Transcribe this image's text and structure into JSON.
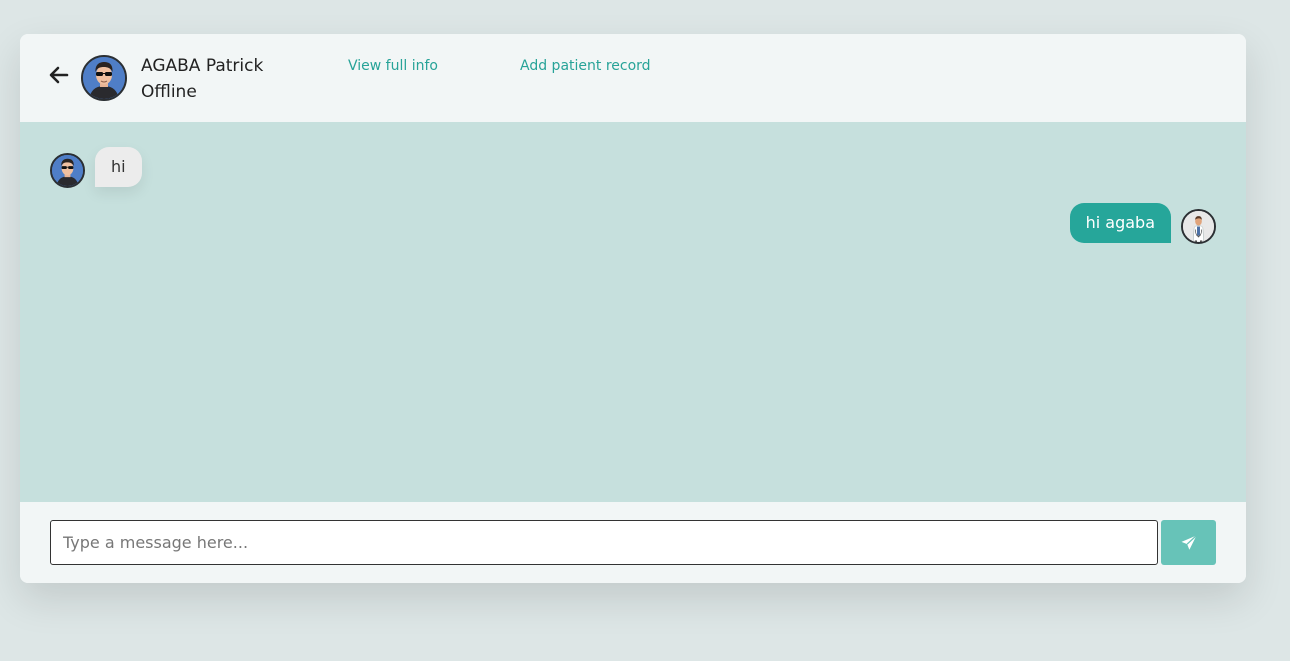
{
  "header": {
    "back_icon": "arrow-left-icon",
    "contact_name": "AGABA Patrick",
    "contact_status": "Offline",
    "view_info_label": "View full info",
    "add_record_label": "Add patient record"
  },
  "messages": [
    {
      "direction": "incoming",
      "text": "hi",
      "avatar": "patient-avatar"
    },
    {
      "direction": "outgoing",
      "text": "hi agaba",
      "avatar": "doctor-avatar"
    }
  ],
  "composer": {
    "placeholder": "Type a message here...",
    "value": "",
    "send_icon": "paper-plane-icon"
  },
  "colors": {
    "accent": "#26a69a",
    "link": "#27a398",
    "chat_background": "#c6e0dd",
    "send_button": "#67c3b8"
  }
}
